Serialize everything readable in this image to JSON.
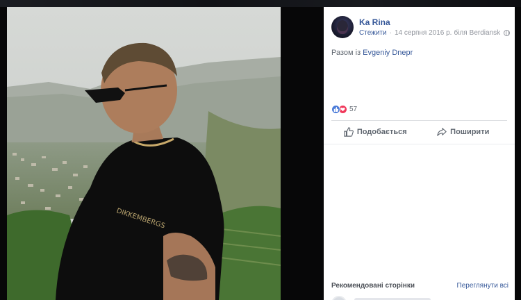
{
  "post": {
    "author": "Ka Rina",
    "follow_label": "Стежити",
    "separator": "·",
    "date": "14 серпня 2016 р.",
    "location_prefix": "біля",
    "location": "Berdiansk",
    "privacy_icon": "globe-icon",
    "with_prefix": "Разом із",
    "tagged_name": "Evgeniy Dnepr"
  },
  "reactions": {
    "icons": [
      "like-icon",
      "love-icon"
    ],
    "count": "57"
  },
  "actions": {
    "like_label": "Подобається",
    "share_label": "Поширити"
  },
  "recommended": {
    "title": "Рекомендовані сторінки",
    "see_all": "Переглянути всі"
  },
  "colors": {
    "link_blue": "#365899",
    "like_blue": "#4a7bd8",
    "love_red": "#f0385a",
    "backdrop": "#070708"
  }
}
